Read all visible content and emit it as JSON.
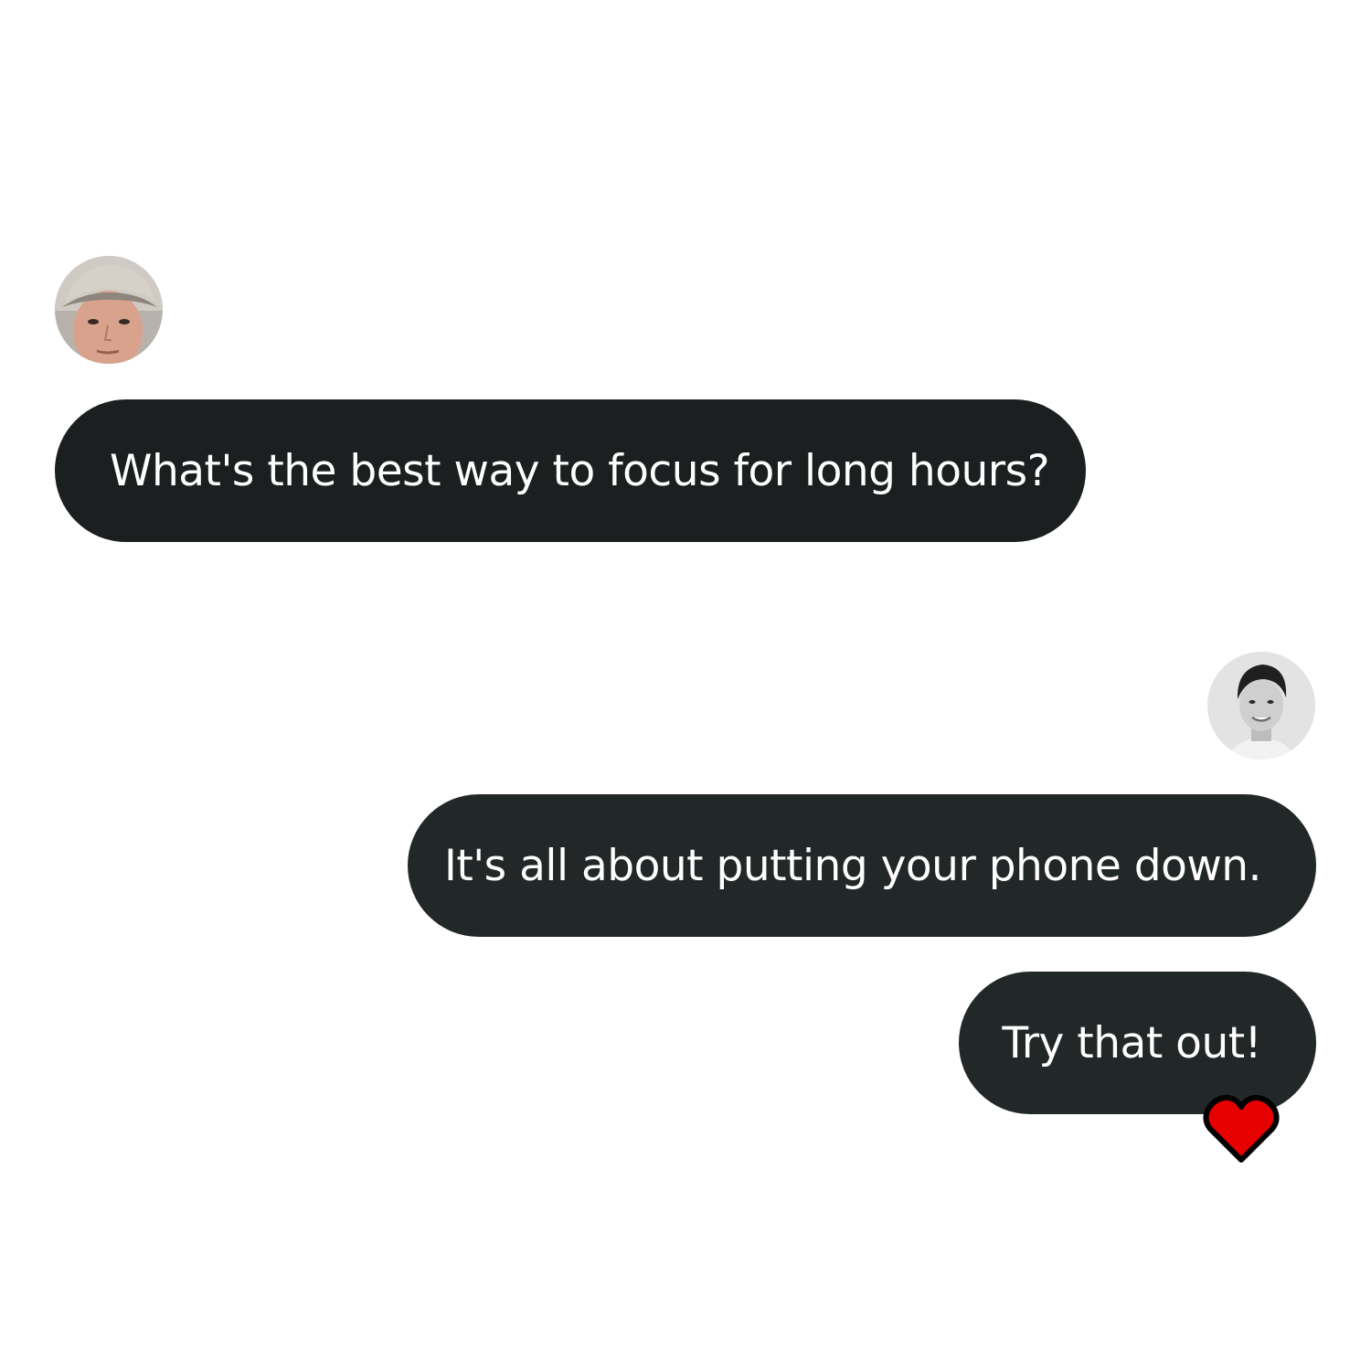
{
  "conversation": {
    "messages": [
      {
        "sender": "other",
        "text": "What's the best way to focus for long hours?"
      },
      {
        "sender": "self",
        "text": "It's all about putting your phone down."
      },
      {
        "sender": "self",
        "text": "Try that out!"
      }
    ],
    "reaction": {
      "icon": "heart-icon",
      "color": "#e60000"
    }
  },
  "colors": {
    "bubble_dark": "#1b1f1f",
    "bubble_self": "#222828",
    "text": "#ffffff",
    "background": "#ffffff"
  }
}
